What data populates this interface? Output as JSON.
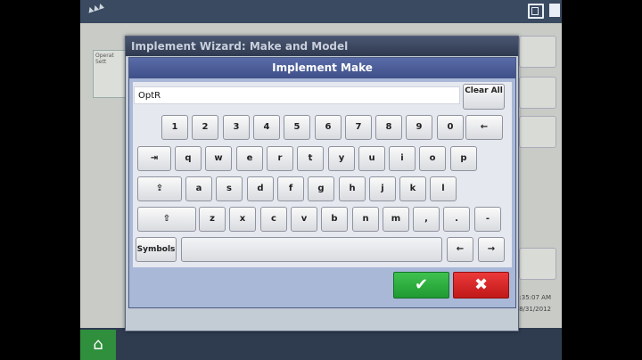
{
  "background": {
    "left_panel_lines": [
      "Operat",
      "Sett"
    ],
    "time": "3:35:07 AM",
    "date": "8/31/2012"
  },
  "wizard": {
    "title": "Implement Wizard:  Make and Model"
  },
  "dialog": {
    "title": "Implement Make",
    "input_value": "OptR",
    "clear_all": "Clear All"
  },
  "keyboard": {
    "row1": [
      "1",
      "2",
      "3",
      "4",
      "5",
      "6",
      "7",
      "8",
      "9",
      "0"
    ],
    "row2": [
      "q",
      "w",
      "e",
      "r",
      "t",
      "y",
      "u",
      "i",
      "o",
      "p"
    ],
    "row3": [
      "a",
      "s",
      "d",
      "f",
      "g",
      "h",
      "j",
      "k",
      "l"
    ],
    "row4": [
      "z",
      "x",
      "c",
      "v",
      "b",
      "n",
      "m",
      ",",
      ".",
      "-"
    ],
    "backspace": "←",
    "tab": "⇥",
    "caps": "⇪",
    "shift": "⇧",
    "symbols": "Symbols",
    "left_arrow": "←",
    "right_arrow": "→"
  },
  "actions": {
    "ok": "✔",
    "cancel": "✖"
  },
  "colors": {
    "ok": "#2bb03d",
    "cancel": "#d42020",
    "title_bar": "#4a5bb0"
  },
  "icons": [
    "home-icon",
    "window-icon",
    "menu-icon",
    "check-icon",
    "close-icon"
  ]
}
